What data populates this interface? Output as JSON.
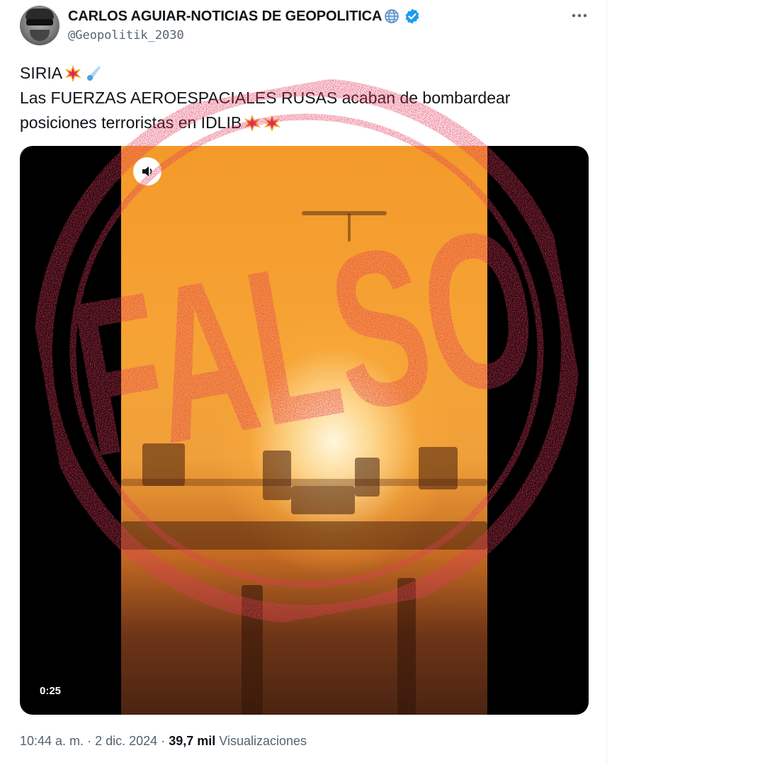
{
  "tweet": {
    "author_name": "CARLOS AGUIAR-NOTICIAS DE GEOPOLITICA",
    "handle": "@Geopolitik_2030",
    "text_line_1": "SIRIA",
    "text_line_2": "Las FUERZAS AEROESPACIALES RUSAS acaban de bombardear",
    "text_line_3": "posiciones terroristas en IDLIB",
    "emojis": [
      "collision-emoji",
      "comet-emoji"
    ]
  },
  "media": {
    "duration": "0:25",
    "mute_icon": "speaker-icon"
  },
  "stamp": {
    "text": "FALSO",
    "color": "#e23a5c"
  },
  "meta": {
    "time": "10:44 a. m.",
    "separator_1": "·",
    "date": "2 dic. 2024",
    "separator_2": "·",
    "views_count": "39,7 mil",
    "views_label": "Visualizaciones"
  },
  "colors": {
    "text_primary": "#0f1419",
    "text_secondary": "#536471",
    "verified_blue": "#1d9bf0"
  }
}
